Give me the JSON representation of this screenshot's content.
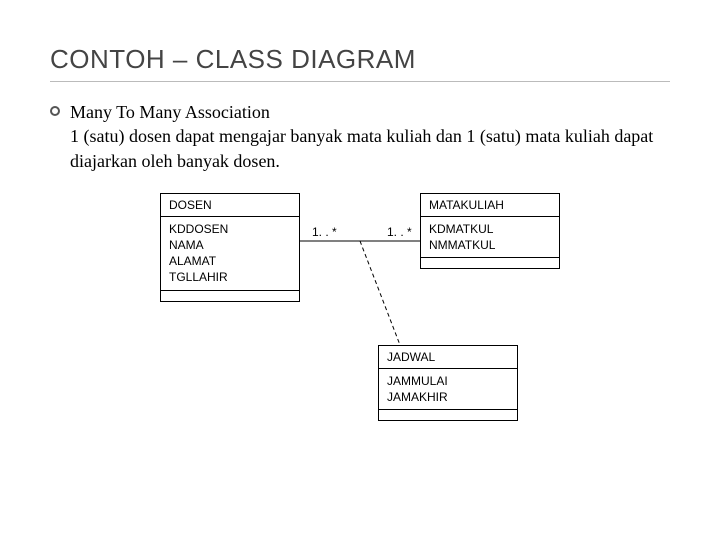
{
  "title": "CONTOH – CLASS DIAGRAM",
  "bullet": {
    "heading": "Many To Many Association",
    "desc": "1 (satu) dosen dapat mengajar banyak mata kuliah dan 1 (satu) mata kuliah dapat diajarkan oleh banyak dosen."
  },
  "classes": {
    "dosen": {
      "name": "DOSEN",
      "attrs": [
        "KDDOSEN",
        "NAMA",
        "ALAMAT",
        "TGLLAHIR"
      ]
    },
    "matakuliah": {
      "name": "MATAKULIAH",
      "attrs": [
        "KDMATKUL",
        "NMMATKUL"
      ]
    },
    "jadwal": {
      "name": "JADWAL",
      "attrs": [
        "JAMMULAI",
        "JAMAKHIR"
      ]
    }
  },
  "association": {
    "left_multiplicity": "1. . *",
    "right_multiplicity": "1. . *"
  }
}
